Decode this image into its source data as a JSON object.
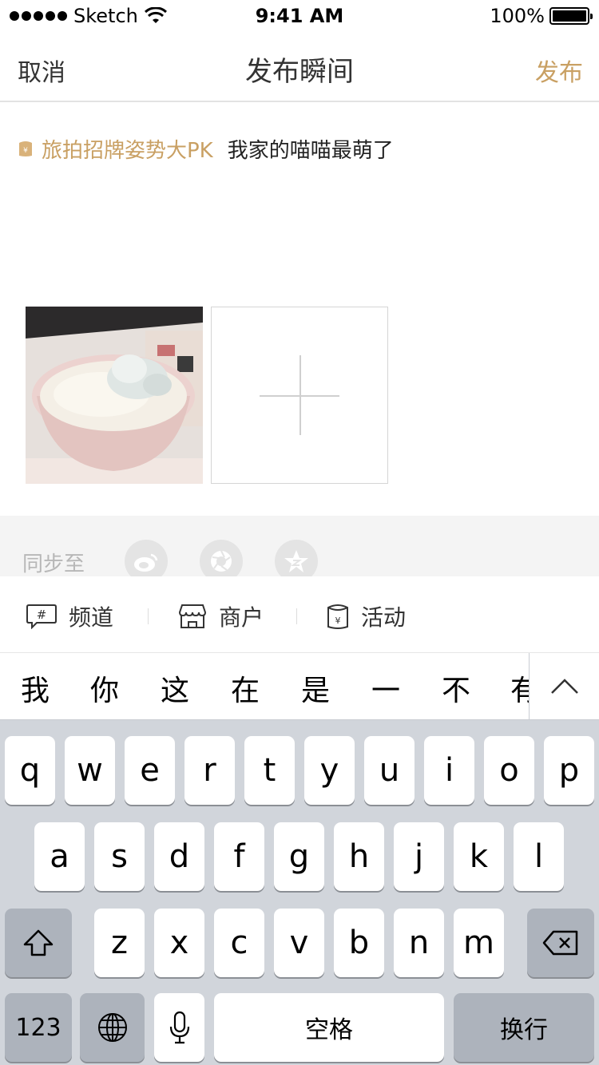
{
  "status_bar": {
    "carrier": "Sketch",
    "time": "9:41 AM",
    "battery": "100%"
  },
  "nav": {
    "cancel": "取消",
    "title": "发布瞬间",
    "publish": "发布"
  },
  "composer": {
    "topic": "旅拍招牌姿势大PK",
    "text": "我家的喵喵最萌了"
  },
  "sync": {
    "label": "同步至",
    "targets": [
      "weibo-icon",
      "camera-aperture-icon",
      "qzone-star-icon"
    ]
  },
  "toolbar": {
    "items": [
      {
        "label": "频道",
        "icon": "channel-hash-icon"
      },
      {
        "label": "商户",
        "icon": "shop-icon"
      },
      {
        "label": "活动",
        "icon": "activity-icon"
      }
    ]
  },
  "candidates": {
    "items": [
      "我",
      "你",
      "这",
      "在",
      "是",
      "一",
      "不",
      "有"
    ]
  },
  "keyboard": {
    "row1": [
      "q",
      "w",
      "e",
      "r",
      "t",
      "y",
      "u",
      "i",
      "o",
      "p"
    ],
    "row2": [
      "a",
      "s",
      "d",
      "f",
      "g",
      "h",
      "j",
      "k",
      "l"
    ],
    "row3": [
      "z",
      "x",
      "c",
      "v",
      "b",
      "n",
      "m"
    ],
    "numbers": "123",
    "space": "空格",
    "return": "换行"
  },
  "colors": {
    "accent": "#c9a063",
    "keyboard_bg": "#d1d5db",
    "function_key": "#adb3bc"
  }
}
